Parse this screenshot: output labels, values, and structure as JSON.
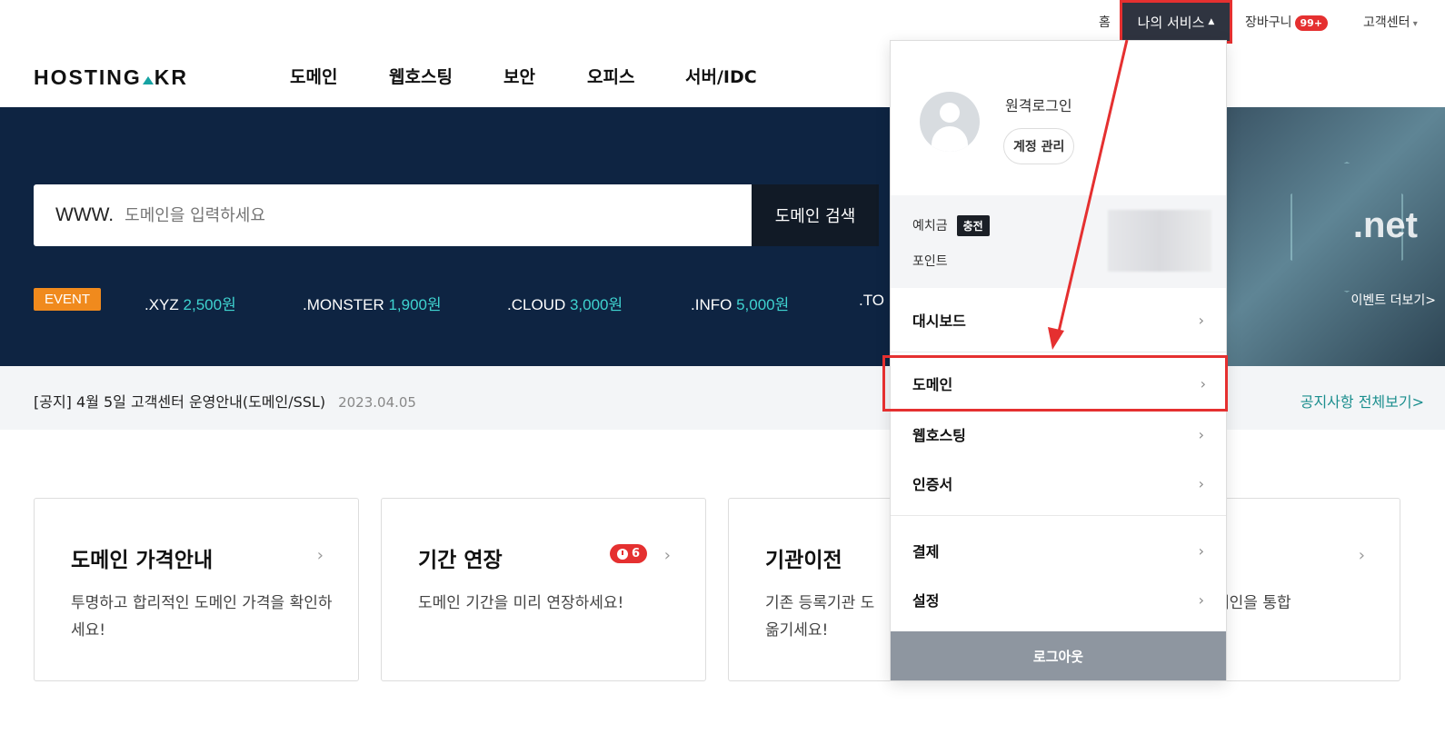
{
  "util_nav": {
    "home": "홈",
    "my_services": "나의 서비스",
    "cart": "장바구니",
    "cart_count": "99+",
    "customer_center": "고객센터"
  },
  "logo": {
    "left": "HOSTING",
    "right": "KR"
  },
  "gnb": [
    "도메인",
    "웹호스팅",
    "보안",
    "오피스",
    "서버/IDC"
  ],
  "search": {
    "prefix": "WWW.",
    "placeholder": "도메인을 입력하세요",
    "button": "도메인 검색"
  },
  "hero_art": {
    "text": ".net",
    "event_more": "이벤트 더보기>"
  },
  "event": {
    "badge": "EVENT",
    "items": [
      {
        "tld": ".XYZ",
        "price": "2,500원"
      },
      {
        "tld": ".MONSTER",
        "price": "1,900원"
      },
      {
        "tld": ".CLOUD",
        "price": "3,000원"
      },
      {
        "tld": ".INFO",
        "price": "5,000원"
      },
      {
        "tld": ".TO",
        "price": ""
      }
    ]
  },
  "notice": {
    "text": "[공지] 4월 5일 고객센터 운영안내(도메인/SSL)",
    "date": "2023.04.05",
    "view_all": "공지사항 전체보기>"
  },
  "cards": [
    {
      "title": "도메인 가격안내",
      "desc": "투명하고 합리적인 도메인 가격을 확인하세요!"
    },
    {
      "title": "기간 연장",
      "desc": "도메인 기간을 미리 연장하세요!",
      "badge": "6"
    },
    {
      "title": "기관이전",
      "desc": "기존 등록기관 도 옮기세요!"
    },
    {
      "title": "",
      "desc": "메인을 통합"
    }
  ],
  "dropdown": {
    "remote_login": "원격로그인",
    "account_manage": "계정 관리",
    "deposit": "예치금",
    "charge": "충전",
    "points": "포인트",
    "menu": [
      "대시보드",
      "도메인",
      "웹호스팅",
      "인증서",
      "결제",
      "설정"
    ],
    "logout": "로그아웃"
  },
  "colors": {
    "hero_bg": "#0e2442",
    "accent_teal": "#3fd3d0",
    "event_orange": "#f08a1d",
    "highlight_red": "#e53030"
  }
}
